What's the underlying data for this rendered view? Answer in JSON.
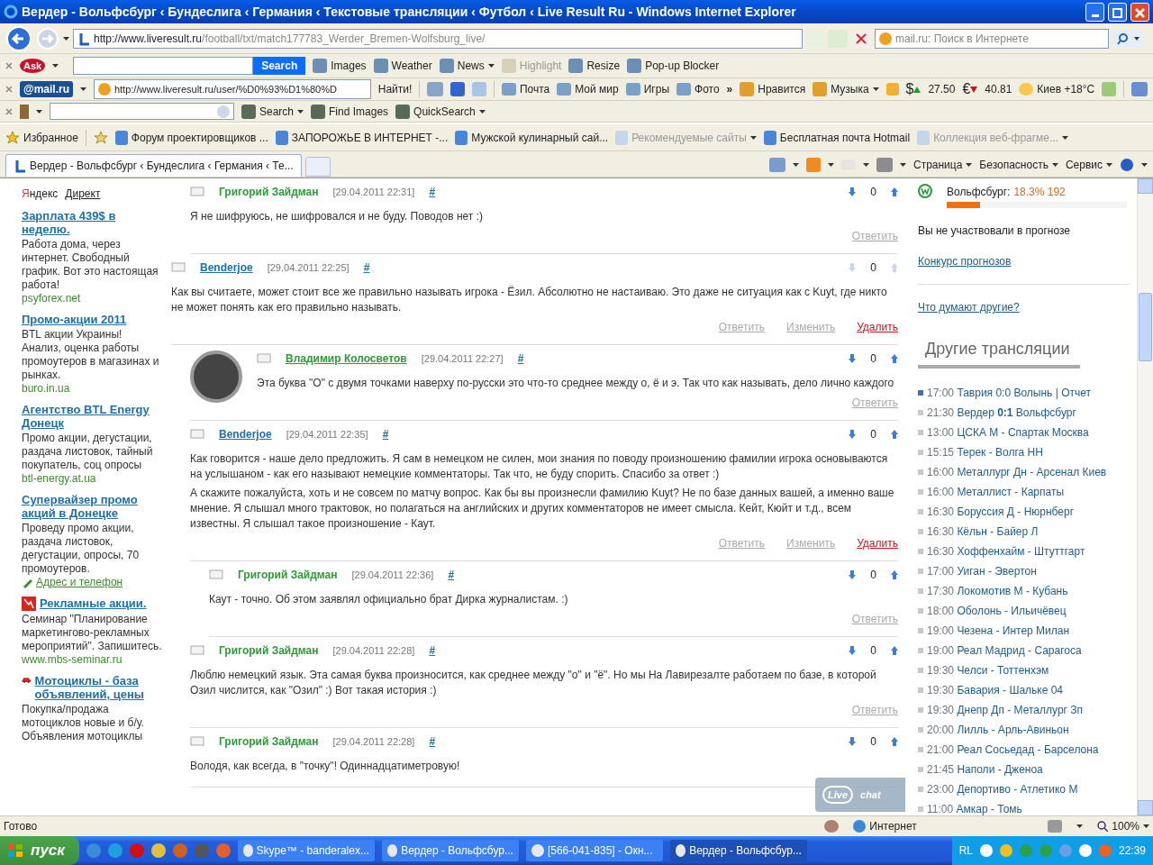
{
  "window": {
    "title": "Вердер - Вольфсбург ‹ Бундеслига ‹ Германия ‹ Текстовые трансляции ‹ Футбол ‹ Live Result Ru - Windows Internet Explorer"
  },
  "address_bar": {
    "url_host": "http://www.liveresult.ru",
    "url_path": "/football/txt/match177783_Werder_Bremen-Wolfsburg_live/",
    "search_placeholder": "mail.ru: Поиск в Интернете"
  },
  "ask_toolbar": {
    "logo": "Ask",
    "search_button": "Search",
    "items": [
      {
        "label": "Images",
        "disabled": false,
        "dropdown": false
      },
      {
        "label": "Weather",
        "disabled": false,
        "dropdown": false
      },
      {
        "label": "News",
        "disabled": false,
        "dropdown": true
      },
      {
        "label": "Highlight",
        "disabled": true,
        "dropdown": false
      },
      {
        "label": "Resize",
        "disabled": false,
        "dropdown": false
      },
      {
        "label": "Pop-up Blocker",
        "disabled": false,
        "dropdown": false
      }
    ]
  },
  "mail_toolbar": {
    "logo": "@mail.ru",
    "url": "http://www.liveresult.ru/user/%D0%93%D1%80%D",
    "find_button": "Найти!",
    "items": [
      {
        "label": "Почта",
        "dropdown": false
      },
      {
        "label": "Мой мир",
        "dropdown": false
      },
      {
        "label": "Игры",
        "dropdown": false
      },
      {
        "label": "Фото",
        "dropdown": false
      }
    ],
    "more": "»",
    "extra_items": [
      {
        "label": "Нравится",
        "dropdown": false
      },
      {
        "label": "Музыка",
        "dropdown": true
      }
    ],
    "rates": [
      {
        "symbol": "$",
        "value": "27.50",
        "rising": true
      },
      {
        "symbol": "€",
        "value": "40.81",
        "rising": false
      }
    ],
    "weather": "Киев +18°C"
  },
  "third_toolbar": {
    "items": [
      {
        "label": "Search",
        "dropdown": true
      },
      {
        "label": "Find Images",
        "dropdown": false
      },
      {
        "label": "QuickSearch",
        "dropdown": true
      }
    ]
  },
  "favorites_bar": {
    "favorites": "Избранное",
    "links": [
      {
        "label": "Форум проектировщиков ...",
        "disabled": false,
        "dropdown": false
      },
      {
        "label": "ЗАПОРОЖЬЕ В ИНТЕРНЕТ -...",
        "disabled": false,
        "dropdown": false
      },
      {
        "label": "Мужской кулинарный сай...",
        "disabled": false,
        "dropdown": false
      },
      {
        "label": "Рекомендуемые сайты",
        "disabled": true,
        "dropdown": true
      },
      {
        "label": "Бесплатная почта Hotmail",
        "disabled": false,
        "dropdown": false
      },
      {
        "label": "Коллекция веб-фрагме...",
        "disabled": true,
        "dropdown": true
      }
    ]
  },
  "tab": {
    "label": "Вердер - Вольфсбург ‹ Бундеслига ‹ Германия ‹ Те...",
    "selected": true
  },
  "command_bar": [
    "Страница",
    "Безопасность",
    "Сервис"
  ],
  "ads": {
    "brand_first": "Я",
    "brand_rest": "ндекс",
    "brand_second": "Директ",
    "items": [
      {
        "kind": "plain",
        "title": "Зарплата 439$ в неделю.",
        "text": "Работа дома, через интернет. Свободный график. Вот это настоящая работа!",
        "footer": "psyforex.net"
      },
      {
        "kind": "plain",
        "title": "Промо-акции 2011",
        "text": "BTL акции Украины! Анализ, оценка работы промоутеров в магазинах и рынках.",
        "footer": "buro.in.ua"
      },
      {
        "kind": "plain",
        "title": "Агентство BTL Energy Донецк",
        "text": "Промо акции, дегустации, раздача листовок, тайный покупатель, соц опросы",
        "footer": "btl-energy.at.ua"
      },
      {
        "kind": "plain",
        "title": "Супервайзер промо акций в Донецке",
        "text": "Проведу промо акции, раздача листовок, дегустации, опросы, 70 промоутеров.",
        "contact_link": "Адрес и телефон"
      },
      {
        "kind": "burst",
        "title": "Рекламные акции.",
        "text": "Семинар \"Планирование маркетингово-рекламных мероприятий\". Запишитесь.",
        "footer": "www.mbs-seminar.ru"
      },
      {
        "kind": "car",
        "title": "Мотоциклы - база объявлений, цены",
        "text": "Покупка/продажа мотоциклов новые и б/у. Объявления мотоциклы"
      }
    ]
  },
  "comments": [
    {
      "kind": "continued",
      "author": "Григорий Зайдман",
      "author_link": false,
      "color": "#2e9b37",
      "date": "[29.04.2011 22:31]",
      "anchor": "#",
      "votes": "0",
      "vote_enabled": true,
      "avatar": false,
      "body": [
        "Я не шифруюсь, не шифровался и не буду. Поводов нет :)"
      ],
      "actions": [
        {
          "label": "Ответить",
          "kind": "reply"
        }
      ]
    },
    {
      "kind": "thread",
      "author": "Benderjoe",
      "author_link": true,
      "color": "#1f6fa8",
      "date": "[29.04.2011 22:25]",
      "anchor": "#",
      "votes": "0",
      "vote_enabled": false,
      "avatar": false,
      "body": [
        "Как вы считаете, может стоит все же правильно называть игрока - Ёзил. Абсолютно не настаиваю. Это даже не ситуация как с Kuyt, где никто не может понять как его правильно называть."
      ],
      "actions": [
        {
          "label": "Ответить",
          "kind": "reply"
        },
        {
          "label": "Изменить",
          "kind": "edit"
        },
        {
          "label": "Удалить",
          "kind": "delete"
        }
      ],
      "children": [
        {
          "kind": "thread",
          "author": "Владимир Колосветов",
          "author_link": true,
          "color": "#2e9b37",
          "date": "[29.04.2011 22:27]",
          "anchor": "#",
          "votes": "0",
          "vote_enabled": true,
          "avatar": true,
          "body": [
            "Эта буква \"О\" с двумя точками наверху по-русски это что-то среднее между о, ё и э. Так что как называть, дело лично каждого"
          ],
          "actions": [
            {
              "label": "Ответить",
              "kind": "reply"
            }
          ]
        },
        {
          "kind": "thread",
          "author": "Benderjoe",
          "author_link": true,
          "color": "#1f6fa8",
          "date": "[29.04.2011 22:35]",
          "anchor": "#",
          "votes": "0",
          "vote_enabled": true,
          "avatar": false,
          "body": [
            "Как говорится - наше дело предложить. Я сам в немецком не силен, мои знания по поводу произношению фамилии игрока основываются на услышаном - как его называют немецкие комментаторы. Так что, не буду спорить. Спасибо за ответ :)",
            "А скажите пожалуйста, хоть и не совсем по матчу вопрос. Как бы вы произнесли фамилию Kuyt? Не по базе данных вашей, а именно ваше мнение. Я слышал много трактовок, но полагаться на английских и других комментаторов не имеет смысла. Кейт, Кюйт и т.д., всем известны. Я слышал такое произношение - Каут."
          ],
          "actions": [
            {
              "label": "Ответить",
              "kind": "reply"
            },
            {
              "label": "Изменить",
              "kind": "edit"
            },
            {
              "label": "Удалить",
              "kind": "delete"
            }
          ],
          "children": [
            {
              "kind": "thread",
              "author": "Григорий Зайдман",
              "author_link": false,
              "color": "#2e9b37",
              "date": "[29.04.2011 22:36]",
              "anchor": "#",
              "votes": "0",
              "vote_enabled": true,
              "avatar": false,
              "body": [
                "Каут - точно. Об этом заявлял официально брат Дирка журналистам. :)"
              ],
              "actions": [
                {
                  "label": "Ответить",
                  "kind": "reply"
                }
              ]
            }
          ]
        },
        {
          "kind": "thread",
          "author": "Григорий Зайдман",
          "author_link": false,
          "color": "#2e9b37",
          "date": "[29.04.2011 22:28]",
          "anchor": "#",
          "votes": "0",
          "vote_enabled": true,
          "avatar": false,
          "body": [
            "Люблю немецкий язык. Эта самая буква произносится, как среднее между \"о\" и \"ё\". Но мы На Лавирезалте работаем по базе, в которой Озил числится, как \"Озил\" :) Вот такая история :)"
          ],
          "actions": [
            {
              "label": "Ответить",
              "kind": "reply"
            }
          ]
        },
        {
          "kind": "thread",
          "author": "Григорий Зайдман",
          "author_link": false,
          "color": "#2e9b37",
          "date": "[29.04.2011 22:28]",
          "anchor": "#",
          "votes": "0",
          "vote_enabled": true,
          "avatar": false,
          "body": [
            "Володя, как всегда, в \"точку\"! Одиннадцатиметровую!"
          ]
        }
      ]
    }
  ],
  "live_chat": {
    "word1": "Live",
    "word2": "chat"
  },
  "forecast": {
    "team": "Вольфсбург:",
    "share": "18.3% 192",
    "level": 0.183,
    "note": "Вы не участвовали в прогнозе",
    "contest_link": "Конкурс прогнозов",
    "others_link": "Что думают другие?"
  },
  "other_broadcasts": {
    "title": "Другие трансляции",
    "matches": [
      {
        "time": "17:00",
        "title": "Таврия 0:0 Волынь | Отчет",
        "selected": true
      },
      {
        "time": "21:30",
        "title": "Вердер **0:1** Вольфсбург",
        "selected": false
      },
      {
        "time": "13:00",
        "title": "ЦСКА М - Спартак Москва",
        "selected": false
      },
      {
        "time": "15:15",
        "title": "Терек - Волга НН",
        "selected": false
      },
      {
        "time": "16:00",
        "title": "Металлург Дн - Арсенал Киев",
        "selected": false
      },
      {
        "time": "16:00",
        "title": "Металлист - Карпаты",
        "selected": false
      },
      {
        "time": "16:30",
        "title": "Боруссия Д - Нюрнберг",
        "selected": false
      },
      {
        "time": "16:30",
        "title": "Кёльн - Байер Л",
        "selected": false
      },
      {
        "time": "16:30",
        "title": "Хоффенхайм - Штуттгарт",
        "selected": false
      },
      {
        "time": "17:00",
        "title": "Уиган - Эвертон",
        "selected": false
      },
      {
        "time": "17:30",
        "title": "Локомотив М - Кубань",
        "selected": false
      },
      {
        "time": "18:00",
        "title": "Оболонь - Ильичёвец",
        "selected": false
      },
      {
        "time": "19:00",
        "title": "Чезена - Интер Милан",
        "selected": false
      },
      {
        "time": "19:00",
        "title": "Реал Мадрид - Сарагоса",
        "selected": false
      },
      {
        "time": "19:30",
        "title": "Челси - Тоттенхэм",
        "selected": false
      },
      {
        "time": "19:30",
        "title": "Бавария - Шальке 04",
        "selected": false
      },
      {
        "time": "19:30",
        "title": "Днепр Дп - Металлург Зп",
        "selected": false
      },
      {
        "time": "20:00",
        "title": "Лилль - Арль-Авиньон",
        "selected": false
      },
      {
        "time": "21:00",
        "title": "Реал Сосьедад - Барселона",
        "selected": false
      },
      {
        "time": "21:45",
        "title": "Наполи - Дженоа",
        "selected": false
      },
      {
        "time": "23:00",
        "title": "Депортиво - Атлетико М",
        "selected": false
      },
      {
        "time": "11:00",
        "title": "Амкар - Томь",
        "selected": false
      }
    ]
  },
  "status_bar": {
    "text": "Готово",
    "zone": "Интернет",
    "zoom": "100%"
  },
  "taskbar": {
    "start": "пуск",
    "tasks": [
      {
        "label": "Skype™ - banderalex...",
        "selected": false
      },
      {
        "label": "Вердер - Вольфсбур...",
        "selected": false
      },
      {
        "label": "[566-041-835] - Окн...",
        "selected": false
      },
      {
        "label": "Вердер - Вольфсбур...",
        "selected": true
      }
    ],
    "language": "RL",
    "clock": "22:39"
  }
}
